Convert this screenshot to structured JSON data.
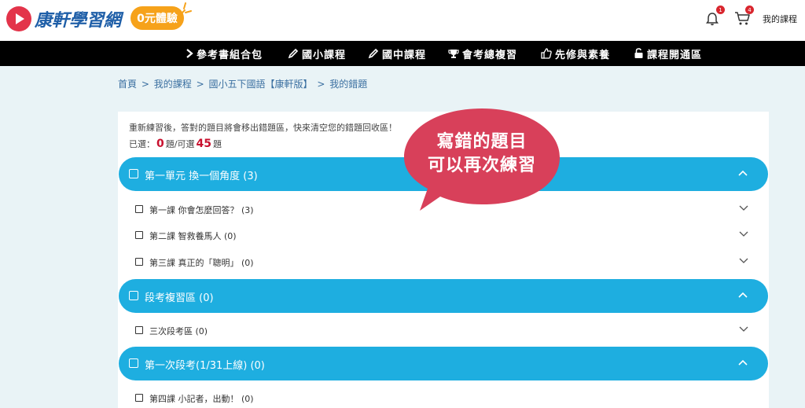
{
  "header": {
    "logo_text": "康軒學習網",
    "trial_label": "0元體驗",
    "bell_badge": "1",
    "cart_badge": "4",
    "my_course": "我的課程"
  },
  "nav": {
    "items": [
      "參考書組合包",
      "國小課程",
      "國中課程",
      "會考總複習",
      "先修與素養",
      "課程開通區"
    ]
  },
  "breadcrumb": {
    "items": [
      "首頁",
      "我的課程",
      "國小五下國語【康軒版】",
      "我的錯題"
    ],
    "separator": ">"
  },
  "info": {
    "description": "重新練習後，答對的題目將會移出錯題區，快來清空您的錯題回收區！",
    "selected_prefix": "已選：",
    "selected_count": "0",
    "selected_mid": "題/可選",
    "available_count": "45",
    "selected_suffix": "題"
  },
  "bubble": {
    "line1": "寫錯的題目",
    "line2": "可以再次練習"
  },
  "units": [
    {
      "title": "第一單元  換一個角度 (3)",
      "lessons": [
        "第一課 你會怎麼回答？ (3)",
        "第二課 智救養馬人 (0)",
        "第三課 真正的「聰明」 (0)"
      ]
    },
    {
      "title": "段考複習區 (0)",
      "lessons": [
        "三次段考區 (0)"
      ]
    },
    {
      "title": "第一次段考(1/31上線) (0)",
      "lessons": [
        "第四課 小記者，出動！ (0)"
      ]
    }
  ],
  "colors": {
    "accent": "#1eaee0",
    "nav_bg": "#000000",
    "bubble": "#d8405a",
    "trial": "#f6a21a",
    "count": "#c8102e"
  }
}
